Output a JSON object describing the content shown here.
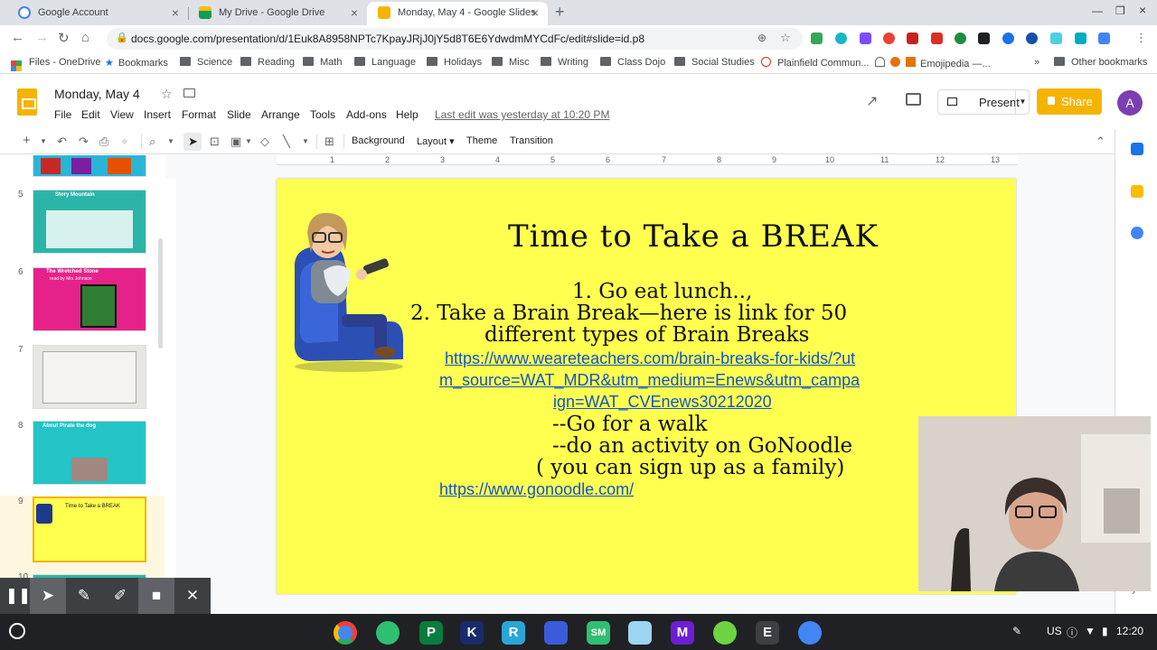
{
  "browser": {
    "tabs": [
      {
        "title": "Google Account",
        "icon": "google-icon",
        "color": "#4285f4"
      },
      {
        "title": "My Drive - Google Drive",
        "icon": "drive-icon",
        "color": "#0f9d58"
      },
      {
        "title": "Monday, May 4 - Google Slides",
        "icon": "slides-icon",
        "color": "#f4b400",
        "active": true
      }
    ],
    "url": "docs.google.com/presentation/d/1Euk8A8958NPTc7KpayJRjJ0jY5d8T6E6YdwdmMYCdFc/edit#slide=id.p8",
    "bookmarks": [
      "Files - OneDrive",
      "Bookmarks",
      "Science",
      "Reading",
      "Math",
      "Language",
      "Holidays",
      "Misc",
      "Writing",
      "Class Dojo",
      "Social Studies",
      "Plainfield Commun...",
      "Emojipedia —..."
    ],
    "other_bookmarks": "Other bookmarks",
    "more_bookmarks": "»"
  },
  "doc": {
    "title": "Monday, May 4",
    "menus": [
      "File",
      "Edit",
      "View",
      "Insert",
      "Format",
      "Slide",
      "Arrange",
      "Tools",
      "Add-ons",
      "Help"
    ],
    "last_edit": "Last edit was yesterday at 10:20 PM",
    "present_label": "Present",
    "share_label": "Share",
    "avatar_letter": "A"
  },
  "toolbar": {
    "background": "Background",
    "layout": "Layout ▾",
    "theme": "Theme",
    "transition": "Transition"
  },
  "ruler": {
    "ticks": [
      "1",
      "2",
      "3",
      "4",
      "5",
      "6",
      "7",
      "8",
      "9",
      "10",
      "11",
      "12",
      "13"
    ]
  },
  "filmstrip": {
    "slides": [
      {
        "num": "5",
        "title": "Story Mountain",
        "bg": "#2bb5a9"
      },
      {
        "num": "6",
        "title": "The Wretched Stone",
        "subtitle": "read by Mrs Johnson",
        "bg": "#e6228a"
      },
      {
        "num": "7",
        "title": "",
        "bg": "#e8e6e1"
      },
      {
        "num": "8",
        "title": "About Pirate the dog",
        "bg": "#24c3c6"
      },
      {
        "num": "9",
        "title": "Time to Take a BREAK",
        "bg": "#ffff50",
        "selected": true
      },
      {
        "num": "10"
      }
    ]
  },
  "slide": {
    "title": "Time to Take a BREAK",
    "lines": [
      "1.  Go eat lunch..,",
      "2. Take a Brain Break—here is  link for 50",
      "different types of Brain Breaks"
    ],
    "link1": [
      "https://www.weareteachers.com/brain-breaks-for-kids/?ut",
      "m_source=WAT_MDR&utm_medium=Enews&utm_campa",
      "ign=WAT_CVEnews30212020"
    ],
    "lines2": [
      "--Go for a walk",
      "--do an activity on GoNoodle",
      "( you can sign up as a family)"
    ],
    "link2": "https://www.gonoodle.com/",
    "colors": {
      "slide_bg": "#ffff50",
      "link": "#1155cc"
    }
  },
  "shelf": {
    "apps": [
      {
        "name": "chrome-app",
        "letter": "",
        "color": "#4285f4"
      },
      {
        "name": "app-green-face",
        "letter": "",
        "color": "#2fbf71"
      },
      {
        "name": "app-p",
        "letter": "P",
        "color": "#0a7c3e"
      },
      {
        "name": "app-k",
        "letter": "K",
        "color": "#1a2b6b"
      },
      {
        "name": "app-r",
        "letter": "R",
        "color": "#2aa6d6"
      },
      {
        "name": "app-grid",
        "letter": "",
        "color": "#3b5bdb"
      },
      {
        "name": "app-sm",
        "letter": "SM",
        "color": "#2fbf71"
      },
      {
        "name": "app-star",
        "letter": "",
        "color": "#9bd5f2"
      },
      {
        "name": "app-m",
        "letter": "M",
        "color": "#6d1ed4"
      },
      {
        "name": "app-leaf",
        "letter": "",
        "color": "#6cd443"
      },
      {
        "name": "app-e",
        "letter": "E",
        "color": "#3c4043"
      },
      {
        "name": "files-app",
        "letter": "",
        "color": "#4285f4"
      }
    ],
    "locale": "US",
    "time": "12:20"
  }
}
